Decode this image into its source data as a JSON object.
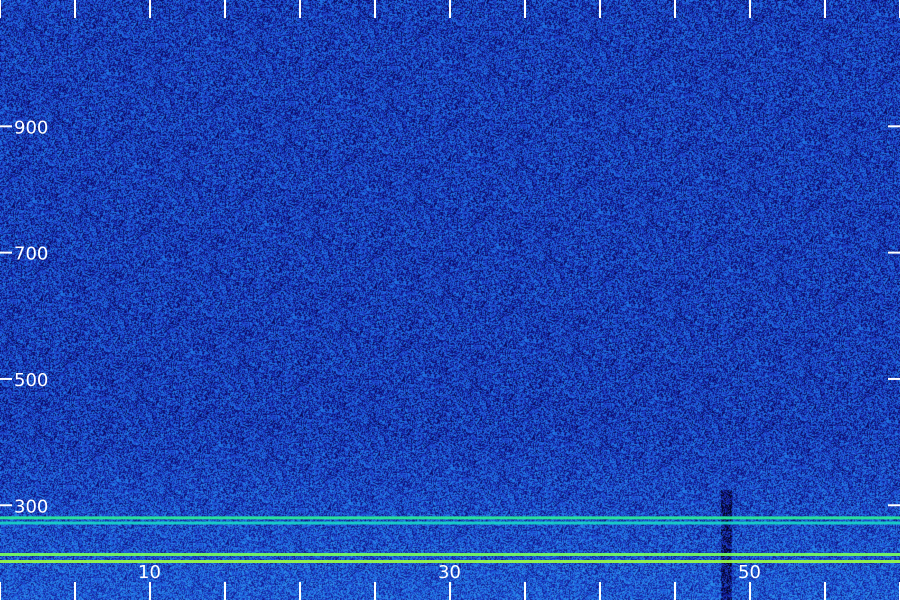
{
  "chart_data": {
    "type": "heatmap",
    "title": "",
    "xlabel": "",
    "ylabel": "",
    "xlim": [
      0,
      60
    ],
    "ylim": [
      150,
      1100
    ],
    "x_ticks_major": [
      10,
      30,
      50
    ],
    "x_ticks_all": [
      0,
      5,
      10,
      15,
      20,
      25,
      30,
      35,
      40,
      45,
      50,
      55,
      60
    ],
    "y_ticks": [
      300,
      500,
      700,
      900
    ],
    "colormap": [
      "#000000",
      "#0a0a6e",
      "#1e3cc8",
      "#1e78e6",
      "#3ca0f0",
      "#00ffa0",
      "#7cff5a"
    ],
    "background_intensity": 0.42,
    "low_y_boost_below": 420,
    "bright_lines": [
      {
        "y": 280,
        "x_end": 60,
        "color": "#2cf09a"
      },
      {
        "y": 272,
        "x_end": 60,
        "color": "#1ad6c8"
      },
      {
        "y": 222,
        "x_end": 60,
        "color": "#7cff5a"
      },
      {
        "y": 211,
        "x_end": 60,
        "color": "#9cff44"
      }
    ],
    "dark_vertical_band_x": 48.4
  }
}
